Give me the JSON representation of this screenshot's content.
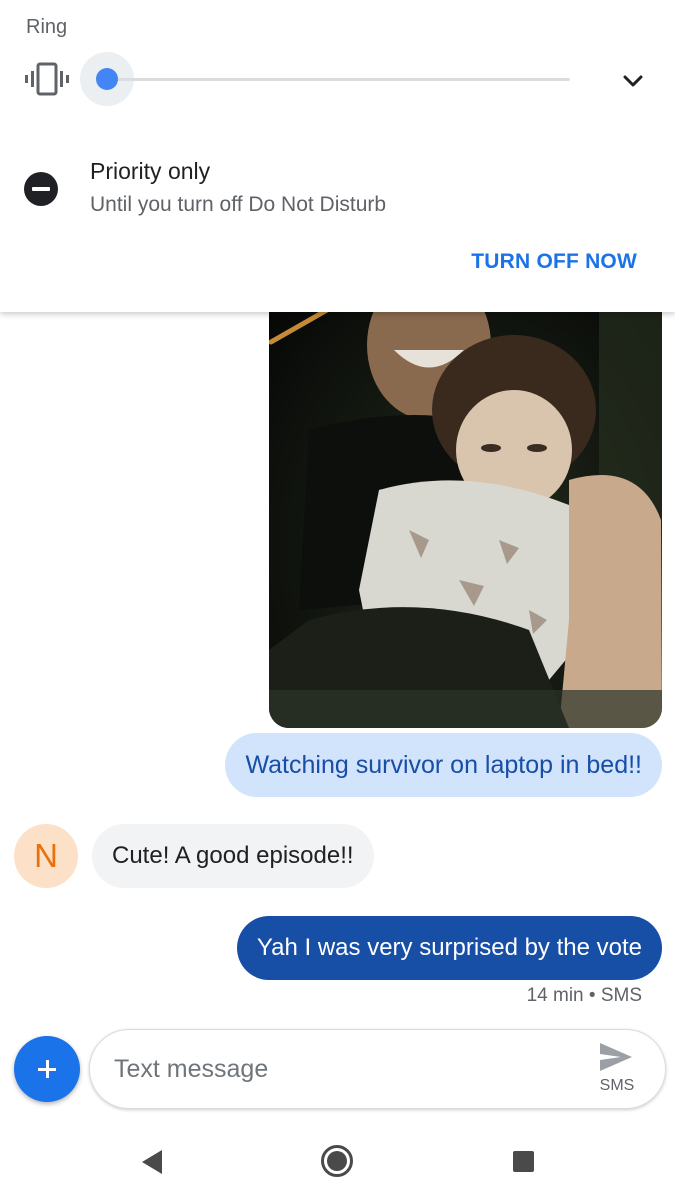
{
  "volume_panel": {
    "ring_label": "Ring",
    "ring_mode_icon": "vibrate-icon",
    "ring_level": 0,
    "expand_icon": "chevron-down-icon",
    "accent_color": "#4285f4"
  },
  "dnd": {
    "icon": "do-not-disturb-icon",
    "title": "Priority only",
    "subtitle": "Until you turn off Do Not Disturb",
    "action": "TURN OFF NOW"
  },
  "conversation": {
    "photo": "photo-attachment",
    "messages": [
      {
        "direction": "outgoing",
        "text": "Watching survivor on laptop in bed!!"
      },
      {
        "direction": "incoming",
        "sender_initial": "N",
        "text": "Cute! A good episode!!"
      },
      {
        "direction": "outgoing",
        "text": "Yah I was very surprised by the vote"
      }
    ],
    "last_meta": "14 min • SMS"
  },
  "compose": {
    "add_icon": "plus-icon",
    "placeholder": "Text message",
    "send_icon": "send-icon",
    "send_label": "SMS"
  },
  "navbar": {
    "back_icon": "back-icon",
    "home_icon": "home-icon",
    "recents_icon": "recents-icon"
  },
  "colors": {
    "outgoing_light_bubble": "#d2e3fc",
    "outgoing_dark_bubble": "#174ea6",
    "incoming_bubble": "#f1f3f4",
    "avatar_bg": "#fce0c8",
    "avatar_text": "#e8710a",
    "primary": "#1a73e8"
  }
}
